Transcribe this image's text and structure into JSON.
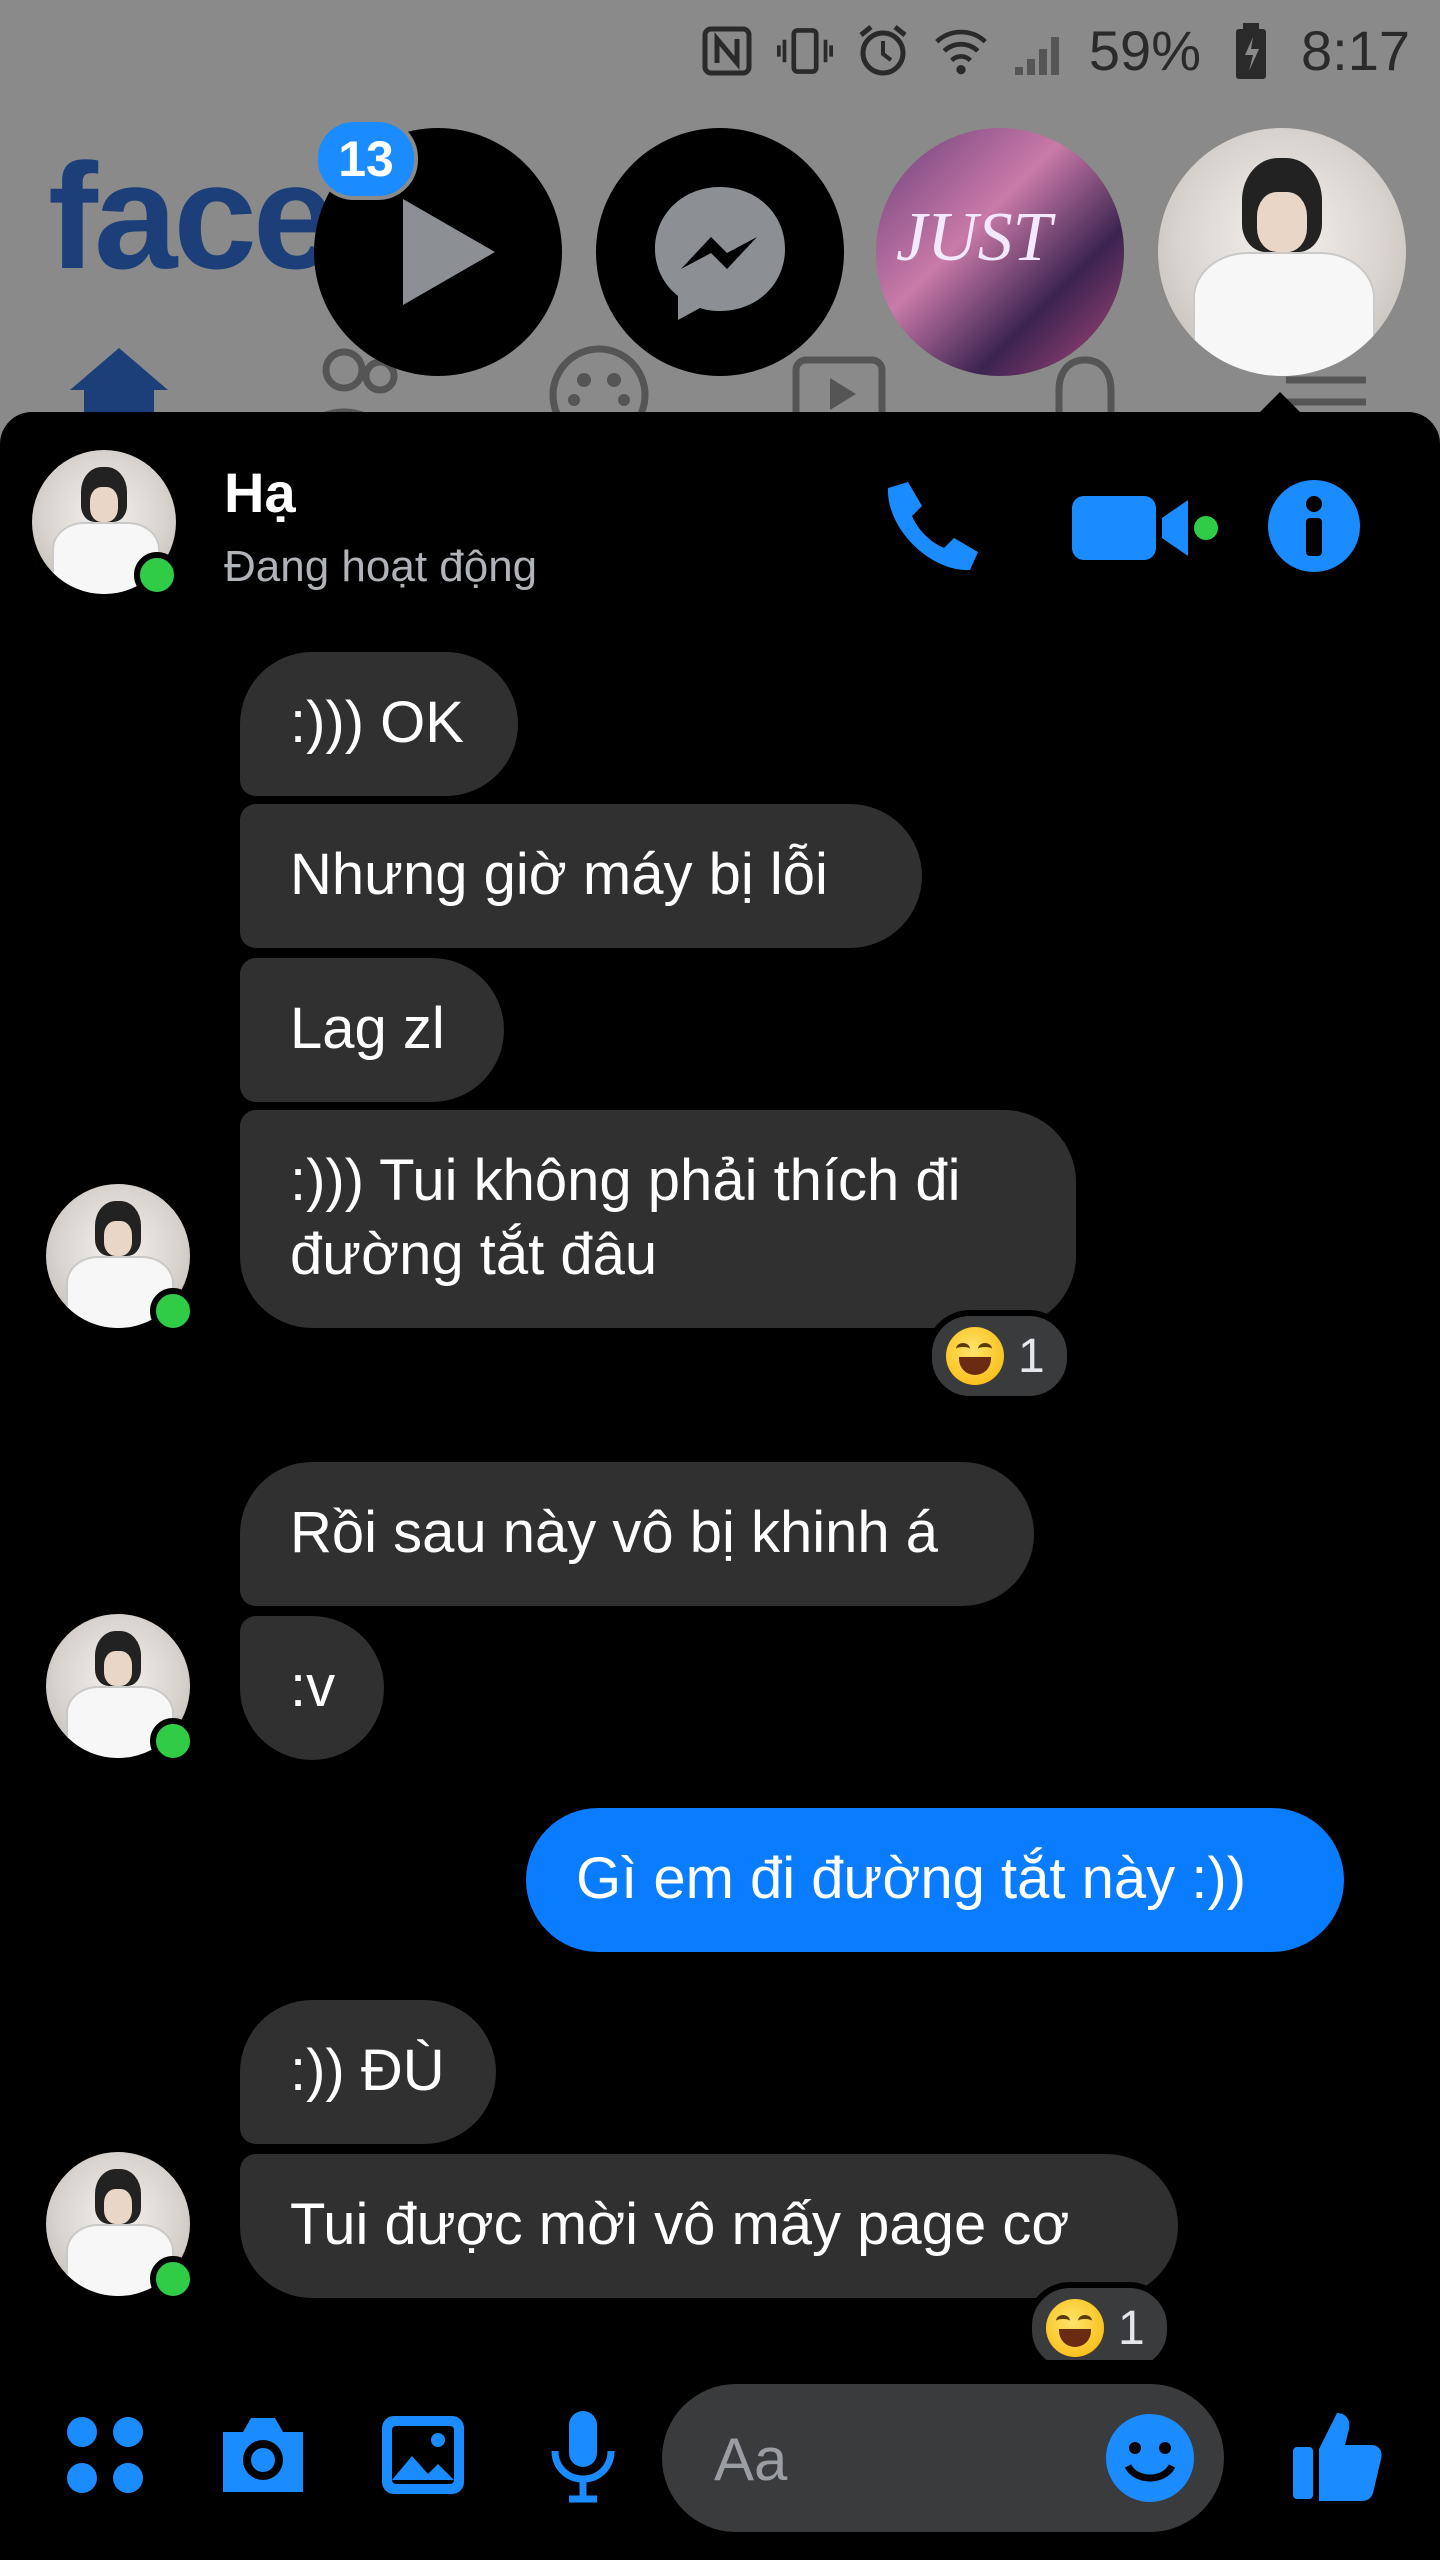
{
  "status_bar": {
    "battery": "59%",
    "time": "8:17"
  },
  "background": {
    "logo_text": "faceb"
  },
  "chat_heads": {
    "badge_count": "13",
    "anime_text": "JUST"
  },
  "header": {
    "name": "Hạ",
    "status": "Đang hoạt động"
  },
  "messages": [
    {
      "text": ":))) OK",
      "direction": "incoming"
    },
    {
      "text": "Nhưng giờ máy bị lỗi",
      "direction": "incoming"
    },
    {
      "text": "Lag zl",
      "direction": "incoming"
    },
    {
      "text": ":))) Tui không phải thích đi",
      "text2": "đường tắt đâu",
      "direction": "incoming",
      "reaction": {
        "count": "1"
      }
    },
    {
      "text": "Rồi sau này vô bị khinh á",
      "direction": "incoming"
    },
    {
      "text": ":v",
      "direction": "incoming"
    },
    {
      "text": "Gì em đi đường tắt này :))",
      "direction": "outgoing"
    },
    {
      "text": ":)) ĐÙ",
      "direction": "incoming"
    },
    {
      "text": "Tui được mời vô mấy page cơ",
      "direction": "incoming",
      "reaction": {
        "count": "1"
      }
    }
  ],
  "composer": {
    "placeholder": "Aa"
  },
  "colors": {
    "accent": "#0a7cff",
    "incoming_bubble": "#303030",
    "online": "#31cc46"
  }
}
